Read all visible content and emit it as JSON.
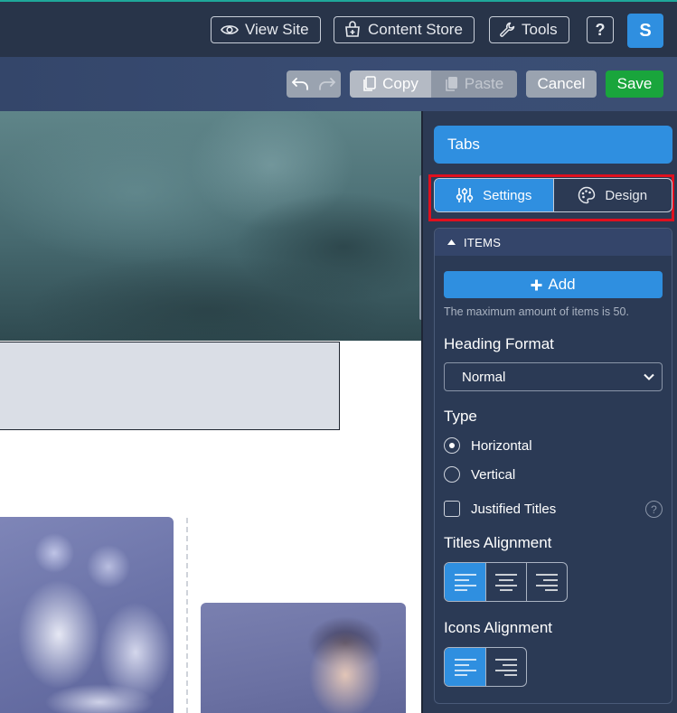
{
  "topbar": {
    "view_site": "View Site",
    "content_store": "Content Store",
    "tools": "Tools",
    "help": "?",
    "avatar_letter": "S"
  },
  "toolbar": {
    "copy": "Copy",
    "paste": "Paste",
    "cancel": "Cancel",
    "save": "Save"
  },
  "panel": {
    "title": "Tabs",
    "tabs": [
      {
        "label": "Settings",
        "active": true
      },
      {
        "label": "Design",
        "active": false
      }
    ],
    "items_section": {
      "title": "ITEMS",
      "add_label": "Add",
      "max_hint": "The maximum amount of items is 50."
    },
    "heading_format": {
      "label": "Heading Format",
      "value": "Normal"
    },
    "type": {
      "label": "Type",
      "options": [
        {
          "label": "Horizontal",
          "checked": true
        },
        {
          "label": "Vertical",
          "checked": false
        }
      ]
    },
    "justified_titles": {
      "label": "Justified Titles",
      "checked": false
    },
    "titles_alignment": {
      "label": "Titles Alignment"
    },
    "icons_alignment": {
      "label": "Icons Alignment"
    }
  },
  "colors": {
    "accent": "#2f8fe0",
    "save": "#19a53c",
    "highlight": "#e0101e",
    "panel_bg": "#2c3a54"
  }
}
